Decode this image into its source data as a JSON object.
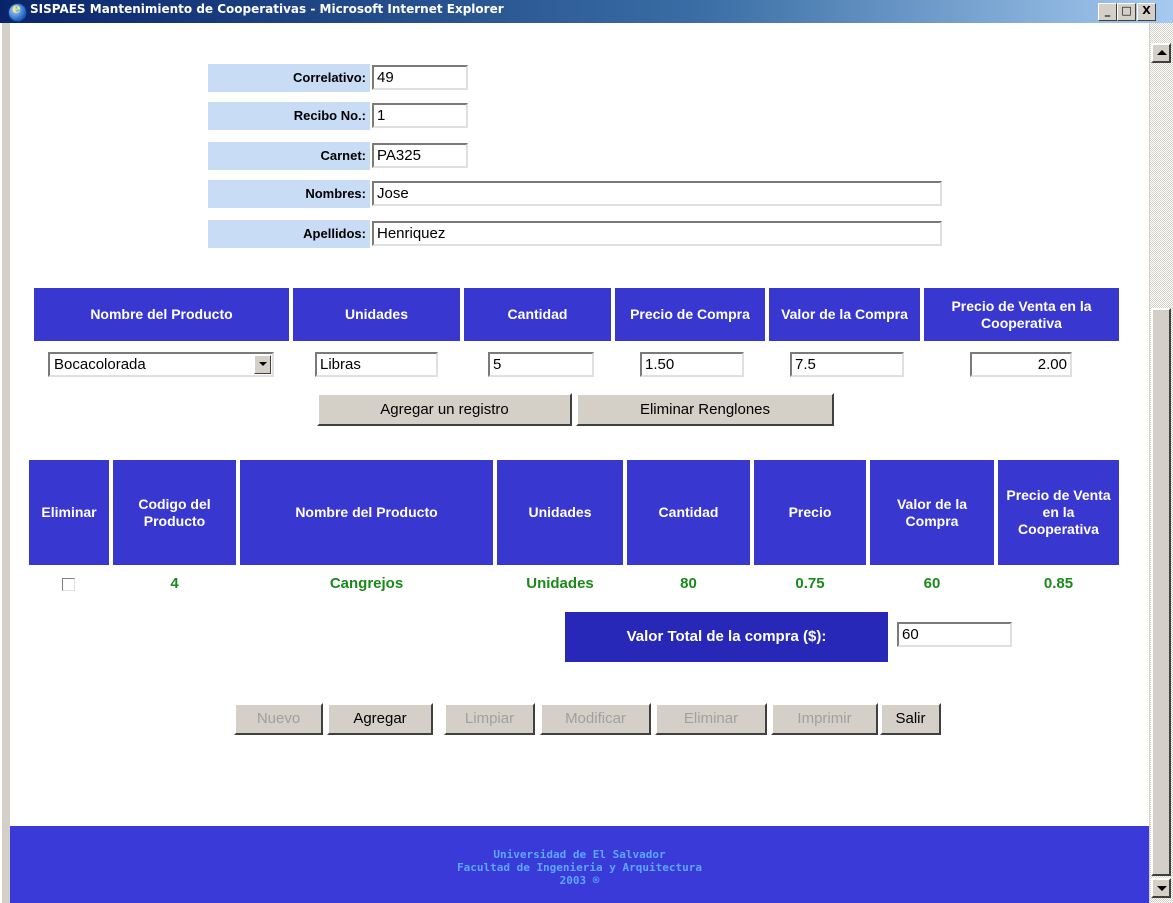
{
  "window": {
    "title": "SISPAES Mantenimiento de Cooperativas - Microsoft Internet Explorer",
    "min": "_",
    "max": "□",
    "close": "X"
  },
  "header_form": {
    "correlativo_label": "Correlativo:",
    "correlativo_value": "49",
    "recibo_label": "Recibo No.:",
    "recibo_value": "1",
    "carnet_label": "Carnet:",
    "carnet_value": "PA325",
    "nombres_label": "Nombres:",
    "nombres_value": "Jose",
    "apellidos_label": "Apellidos:",
    "apellidos_value": "Henriquez"
  },
  "entry": {
    "headers": [
      "Nombre del Producto",
      "Unidades",
      "Cantidad",
      "Precio de Compra",
      "Valor de la Compra",
      "Precio de Venta en la Cooperativa"
    ],
    "producto": "Bocacolorada",
    "unidades": "Libras",
    "cantidad": "5",
    "precio_compra": "1.50",
    "valor_compra": "7.5",
    "precio_venta": "2.00",
    "add_button": "Agregar un registro",
    "delete_rows_button": "Eliminar Renglones"
  },
  "table": {
    "headers": [
      "Eliminar",
      "Codigo del Producto",
      "Nombre del Producto",
      "Unidades",
      "Cantidad",
      "Precio",
      "Valor de la Compra",
      "Precio de Venta en la Cooperativa"
    ],
    "rows": [
      {
        "codigo": "4",
        "nombre": "Cangrejos",
        "unidades": "Unidades",
        "cantidad": "80",
        "precio": "0.75",
        "valor": "60",
        "venta": "0.85"
      }
    ],
    "total_label": "Valor Total de la compra ($):",
    "total_value": "60"
  },
  "actions": {
    "nuevo": "Nuevo",
    "agregar": "Agregar",
    "limpiar": "Limpiar",
    "modificar": "Modificar",
    "eliminar": "Eliminar",
    "imprimir": "Imprimir",
    "salir": "Salir"
  },
  "footer": {
    "line1": "Universidad de El Salvador",
    "line2": "Facultad de Ingenieria y Arquitectura",
    "line3": "2003 ®"
  }
}
